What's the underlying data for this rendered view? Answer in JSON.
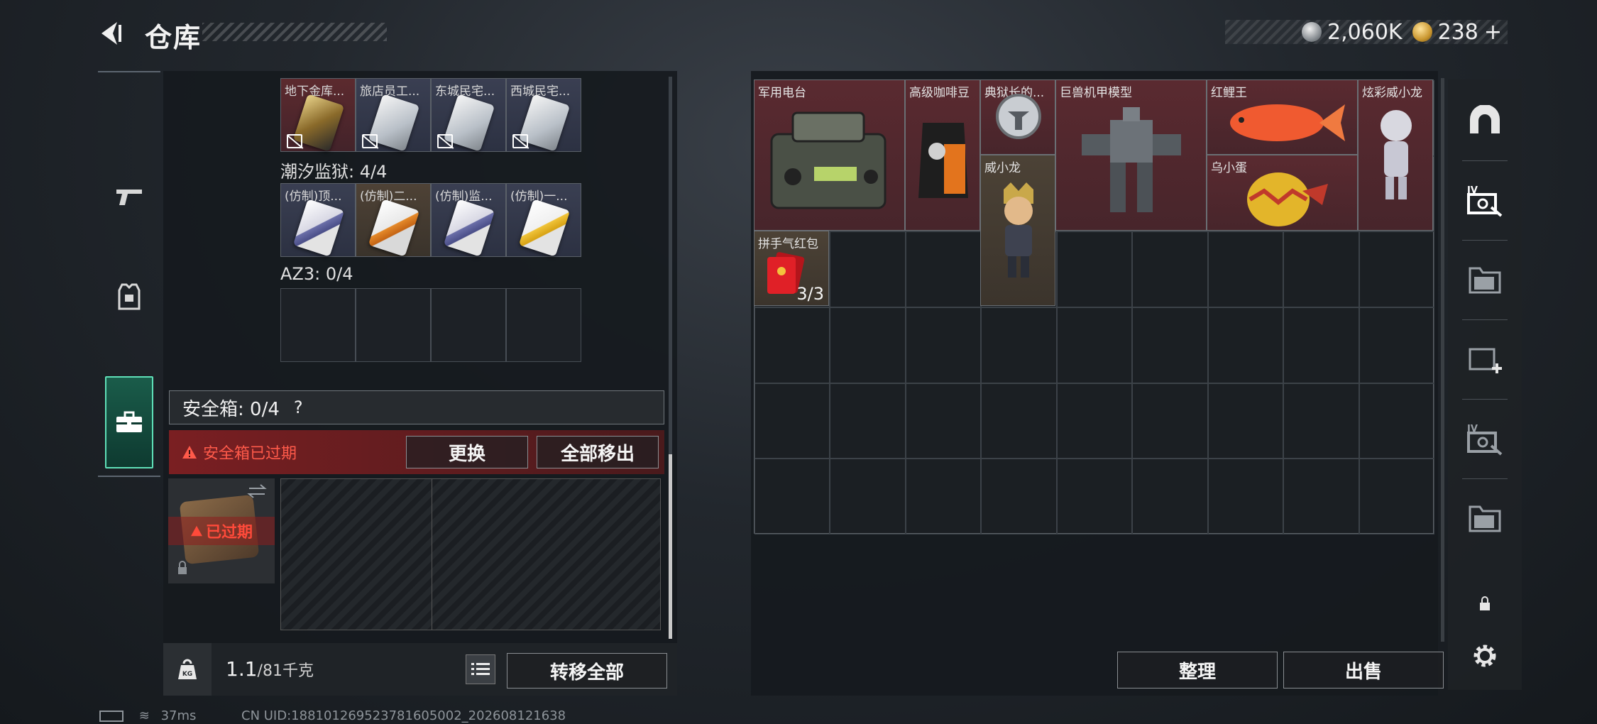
{
  "header": {
    "title": "仓库",
    "currency_silver": "2,060K",
    "currency_gold": "238",
    "gold_plus": "+"
  },
  "left": {
    "row1": [
      {
        "label": "地下金库...",
        "style": "gold",
        "lost": true
      },
      {
        "label": "旅店员工...",
        "style": "silver",
        "lost": true
      },
      {
        "label": "东城民宅...",
        "style": "silver",
        "lost": true
      },
      {
        "label": "西城民宅...",
        "style": "silver",
        "lost": true
      }
    ],
    "section2_label": "潮汐监狱: 4/4",
    "row2": [
      {
        "label": "(仿制)顶...",
        "style": "violet"
      },
      {
        "label": "(仿制)二...",
        "style": "orange"
      },
      {
        "label": "(仿制)监...",
        "style": "violet"
      },
      {
        "label": "(仿制)一...",
        "style": "yellow"
      }
    ],
    "section3_label": "AZ3: 0/4",
    "safe_label": "安全箱: 0/4",
    "safe_help": "?",
    "expired_warning": "安全箱已过期",
    "replace_button": "更换",
    "move_all_out_button": "全部移出",
    "expired_tag": "已过期",
    "weight_value": "1.1",
    "weight_max": "/81千克",
    "kg_icon_text": "KG",
    "transfer_all_button": "转移全部"
  },
  "right": {
    "items": [
      {
        "label": "军用电台"
      },
      {
        "label": "高级咖啡豆"
      },
      {
        "label": "典狱长的..."
      },
      {
        "label": "巨兽机甲模型"
      },
      {
        "label": "红鲤王"
      },
      {
        "label": "炫彩威小龙"
      },
      {
        "label": "威小龙"
      },
      {
        "label": "乌小蛋"
      },
      {
        "label": "拼手气红包",
        "count": "3/3"
      }
    ],
    "sort_button": "整理",
    "sell_button": "出售"
  },
  "status": {
    "ping": "37ms",
    "uid": "CN UID:18810126952378160500​2_202608121638"
  }
}
